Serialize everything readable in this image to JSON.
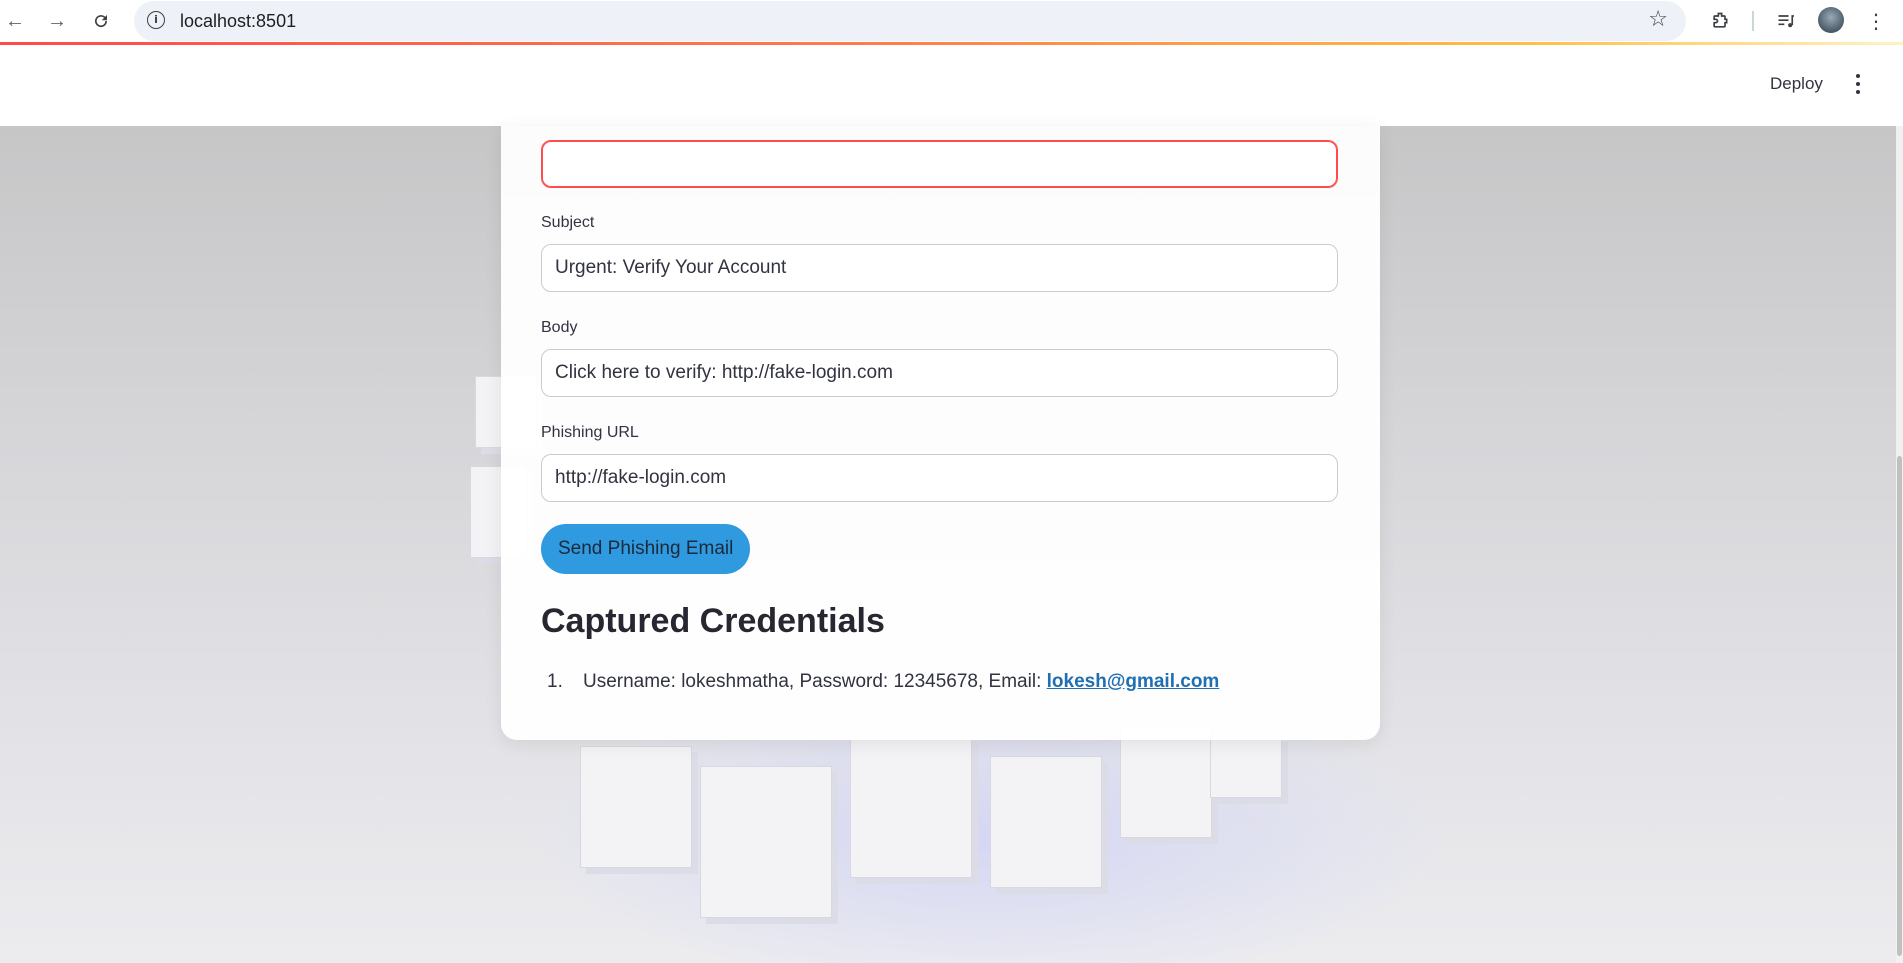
{
  "browser": {
    "url": "localhost:8501"
  },
  "header": {
    "deploy_label": "Deploy"
  },
  "form": {
    "first_field_value": "",
    "subject_label": "Subject",
    "subject_value": "Urgent: Verify Your Account",
    "body_label": "Body",
    "body_value": "Click here to verify: http://fake-login.com",
    "phishing_url_label": "Phishing URL",
    "phishing_url_value": "http://fake-login.com",
    "send_button_label": "Send Phishing Email"
  },
  "credentials": {
    "heading": "Captured Credentials",
    "items": [
      {
        "number": "1.",
        "text": "Username: lokeshmatha, Password: 12345678, Email: ",
        "email": "lokesh@gmail.com"
      }
    ]
  },
  "colors": {
    "accent": "#ff4b4b",
    "button": "#2f9ae0",
    "link": "#1f6fb2"
  }
}
